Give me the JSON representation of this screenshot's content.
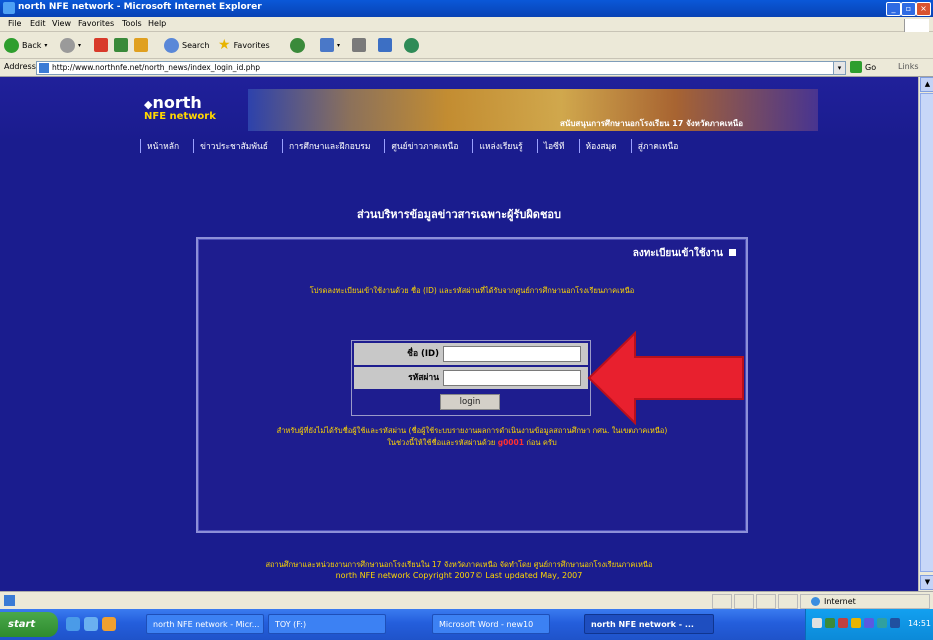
{
  "window": {
    "title": "north NFE network - Microsoft Internet Explorer"
  },
  "menu": [
    "File",
    "Edit",
    "View",
    "Favorites",
    "Tools",
    "Help"
  ],
  "toolbar": {
    "back_label": "Back",
    "search_label": "Search",
    "favorites_label": "Favorites"
  },
  "address": {
    "label": "Address",
    "url": "http://www.northnfe.net/north_news/index_login_id.php",
    "go_label": "Go",
    "links_label": "Links"
  },
  "site": {
    "logo_north": "north",
    "logo_nfe": "NFE network",
    "banner_tagline": "สนับสนุนการศึกษานอกโรงเรียน 17 จังหวัดภาคเหนือ",
    "nav": [
      "หน้าหลัก",
      "ข่าวประชาสัมพันธ์",
      "การศึกษาและฝึกอบรม",
      "ศูนย์ข่าวภาคเหนือ",
      "แหล่งเรียนรู้",
      "ไอซีที",
      "ห้องสมุด",
      "สู่ภาคเหนือ"
    ],
    "page_heading": "ส่วนบริหารข้อมูลข่าวสารเฉพาะผู้รับผิดชอบ"
  },
  "login": {
    "panel_title": "ลงทะเบียนเข้าใช้งาน",
    "instruction": "โปรดลงทะเบียนเข้าใช้งานด้วย ชื่อ (ID) และรหัสผ่านที่ได้รับจากศูนย์การศึกษานอกโรงเรียนภาคเหนือ",
    "id_label": "ชื่อ (ID)",
    "password_label": "รหัสผ่าน",
    "id_value": "",
    "password_value": "",
    "button_label": "login",
    "note_line1": "สำหรับผู้ที่ยังไม่ได้รับชื่อผู้ใช้และรหัสผ่าน (ชื่อผู้ใช้ระบบรายงานผลการดำเนินงานข้อมูลสถานศึกษา กศน. ในเขตภาคเหนือ)",
    "note_line2_prefix": "ในช่วงนี้ให้ใช้ชื่อและรหัสผ่านด้วย",
    "note_line2_code": "g0001",
    "note_line2_suffix": "ก่อน ครับ"
  },
  "footer": {
    "line1": "สถานศึกษาและหน่วยงานการศึกษานอกโรงเรียนใน 17 จังหวัดภาคเหนือ จัดทำโดย ศูนย์การศึกษานอกโรงเรียนภาคเหนือ",
    "line2": "north NFE network Copyright 2007© Last updated May, 2007"
  },
  "status": {
    "zone": "Internet"
  },
  "taskbar": {
    "start_label": "start",
    "tasks": [
      "north NFE network - Micr...",
      "TOY (F:)",
      "Microsoft Word - new10",
      "north NFE network - ..."
    ],
    "clock": "14:51"
  },
  "colors": {
    "page_bg": "#1a1c8e",
    "highlight_arrow": "#e8202e",
    "accent_yellow": "#ffd700",
    "xp_blue": "#245edc"
  }
}
